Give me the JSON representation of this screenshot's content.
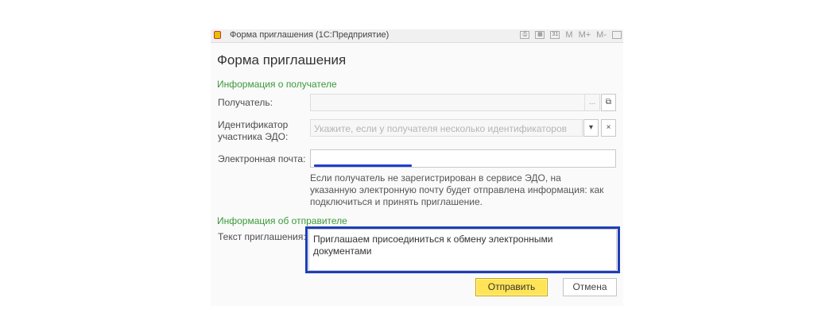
{
  "window": {
    "title": "Форма приглашения  (1С:Предприятие)",
    "toolbar": [
      "M",
      "M+",
      "M-"
    ]
  },
  "form": {
    "title": "Форма приглашения",
    "recipient_section": "Информация о получателе",
    "recipient_label": "Получатель:",
    "edo_id_label": "Идентификатор участника ЭДО:",
    "edo_id_placeholder": "Укажите, если у получателя несколько идентификаторов",
    "email_label": "Электронная почта:",
    "hint": [
      "Если получатель не зарегистрирован в сервисе ЭДО, на",
      "указанную электронную почту будет отправлена информация: как",
      "подключиться и принять приглашение."
    ],
    "sender_section": "Информация об отправителе",
    "invite_text_label": "Текст приглашения:",
    "invite_text": "Приглашаем присоединиться к обмену электронными документами",
    "send_button": "Отправить",
    "cancel_button": "Отмена"
  },
  "colors": {
    "section": "#3a9a3a",
    "primary_button": "#ffe457",
    "highlight": "#1d3fb8"
  }
}
